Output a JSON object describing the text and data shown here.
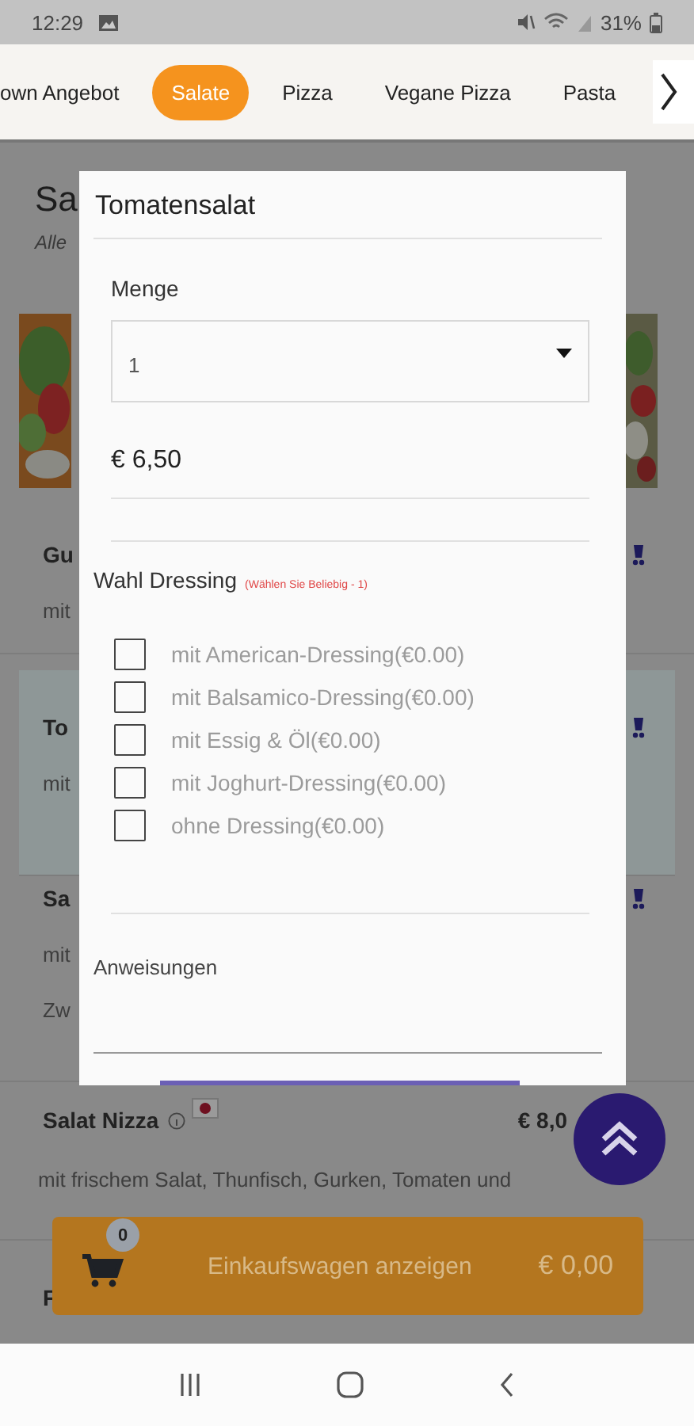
{
  "status_bar": {
    "time": "12:29",
    "battery": "31%"
  },
  "category_tabs": [
    {
      "label": "own Angebot",
      "selected": false
    },
    {
      "label": "Salate",
      "selected": true
    },
    {
      "label": "Pizza",
      "selected": false
    },
    {
      "label": "Vegane Pizza",
      "selected": false
    },
    {
      "label": "Pasta",
      "selected": false
    }
  ],
  "background": {
    "title": "Sa",
    "subtitle": "Alle",
    "items": [
      {
        "kind": "covered",
        "name": "Gu",
        "description": [
          "mit"
        ],
        "highlighted": false
      },
      {
        "kind": "covered",
        "name": "To",
        "description": [
          "mit"
        ],
        "highlighted": true
      },
      {
        "kind": "covered",
        "name": "Sa",
        "description": [
          "mit",
          "Zw"
        ],
        "highlighted": false
      },
      {
        "kind": "full",
        "name": "Salat Nizza",
        "price": "€ 8,0",
        "description": [
          "mit frischem Salat, Thunfisch, Gurken, Tomaten und"
        ],
        "highlighted": false
      },
      {
        "kind": "covered",
        "name": "F",
        "highlighted": false
      }
    ]
  },
  "dialog": {
    "title": "Tomatensalat",
    "quantity": {
      "label": "Menge",
      "value": "1"
    },
    "price": "€ 6,50",
    "option_group": {
      "title": "Wahl Dressing",
      "hint": "(Wählen Sie Beliebig - 1)",
      "options": [
        {
          "label": "mit American-Dressing(€0.00)",
          "checked": false
        },
        {
          "label": "mit Balsamico-Dressing(€0.00)",
          "checked": false
        },
        {
          "label": "mit Essig & Öl(€0.00)",
          "checked": false
        },
        {
          "label": "mit Joghurt-Dressing(€0.00)",
          "checked": false
        },
        {
          "label": "ohne Dressing(€0.00)",
          "checked": false
        }
      ]
    },
    "instructions": {
      "label": "Anweisungen"
    }
  },
  "cart": {
    "count": "0",
    "label": "Einkaufswagen anzeigen",
    "total": "€ 0,00"
  }
}
